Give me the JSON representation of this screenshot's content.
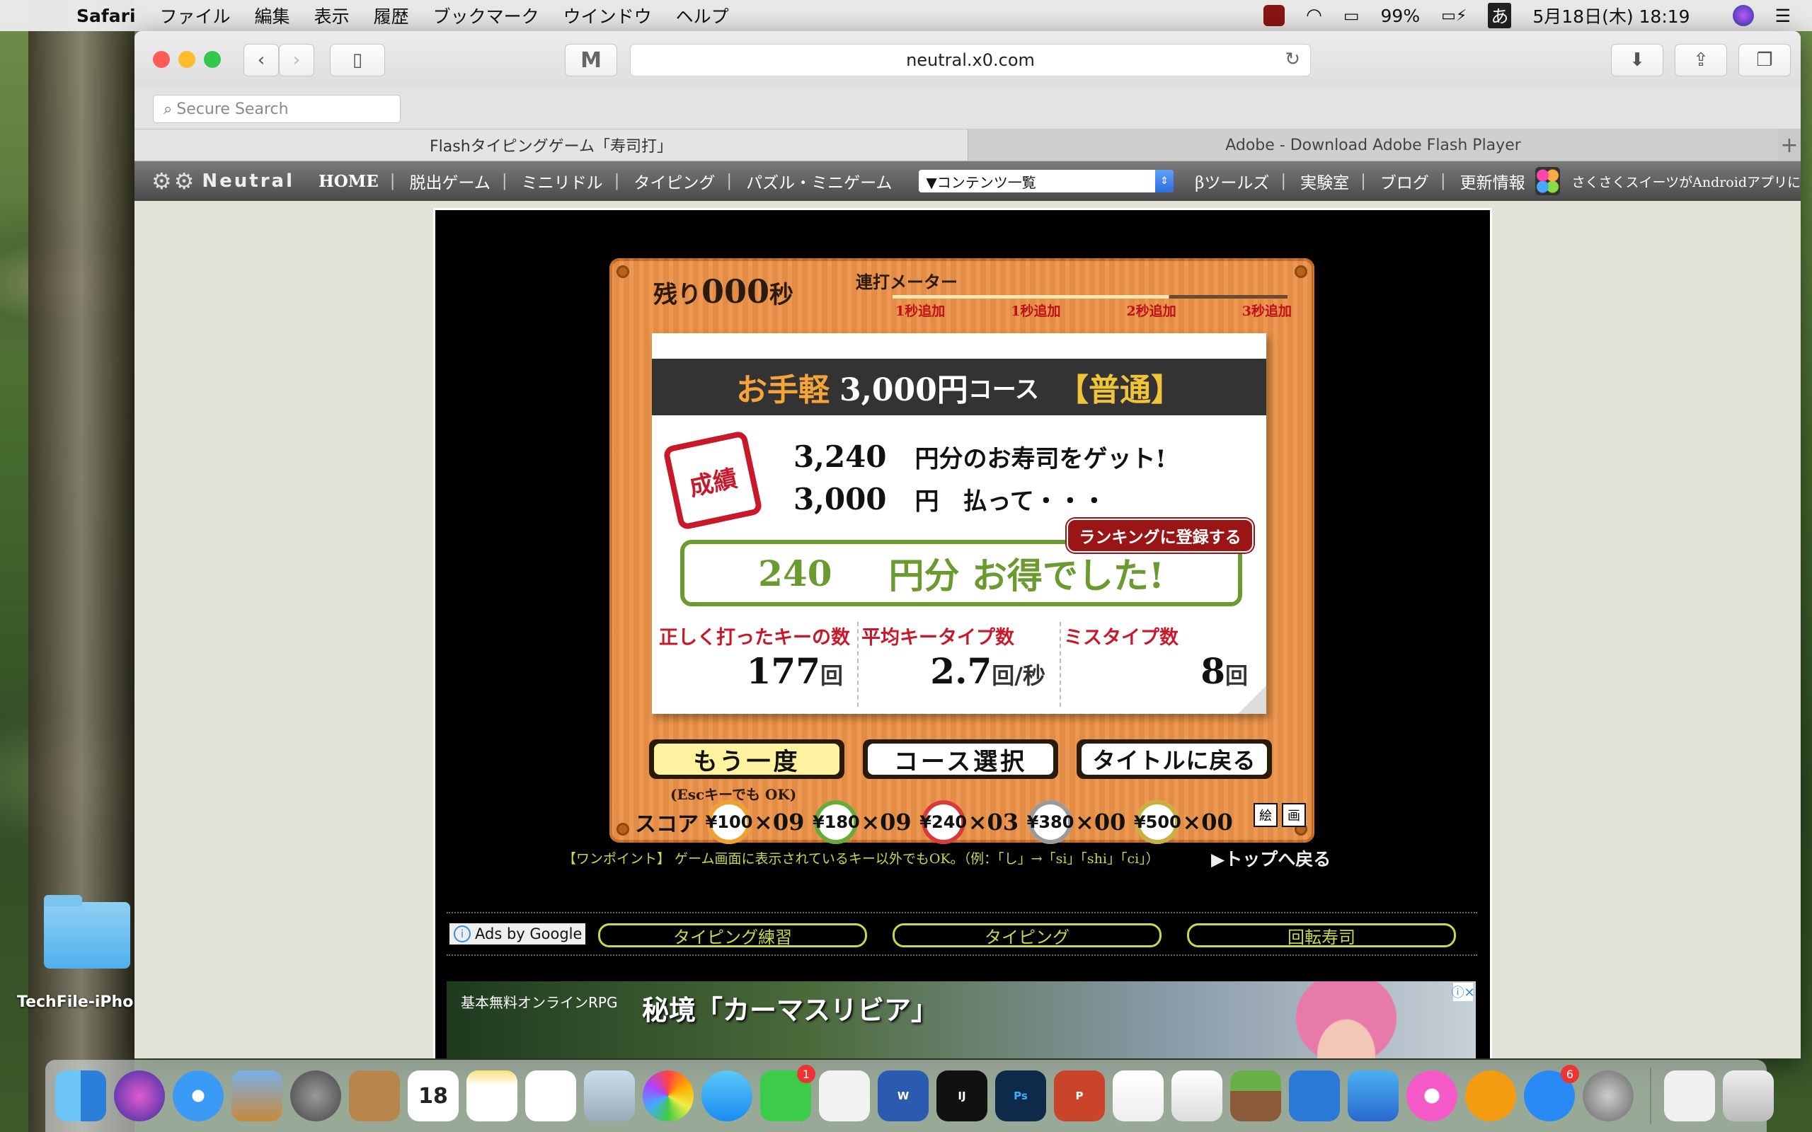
{
  "menubar": {
    "app": "Safari",
    "items": [
      "ファイル",
      "編集",
      "表示",
      "履歴",
      "ブックマーク",
      "ウインドウ",
      "ヘルプ"
    ],
    "battery": "99%",
    "input_method": "あ",
    "datetime": "5月18日(木) 18:19"
  },
  "safari": {
    "url": "neutral.x0.com",
    "search_placeholder": "Secure Search",
    "tabs": [
      {
        "title": "Flashタイピングゲーム「寿司打」"
      },
      {
        "title": "Adobe - Download Adobe Flash Player"
      }
    ],
    "new_tab": "+"
  },
  "site_nav": {
    "logo": "Neutral",
    "items": [
      "HOME",
      "脱出ゲーム",
      "ミニリドル",
      "タイピング",
      "パズル・ミニゲーム"
    ],
    "contents_select": "▼コンテンツ一覧",
    "items2": [
      "βツールズ",
      "実験室",
      "ブログ",
      "更新情報"
    ],
    "news_text": "さくさくスイーツがAndroidアプリに"
  },
  "game": {
    "timer_prefix": "残り",
    "timer_value": "000",
    "timer_unit": "秒",
    "meter_label": "連打メーター",
    "meter_marks": [
      "1秒追加",
      "1秒追加",
      "2秒追加",
      "3秒追加"
    ],
    "course_prefix": "お手軽",
    "course_amount": "3,000円",
    "course_suffix": "コース",
    "course_level": "【普通】",
    "stamp": "成績",
    "earned_value": "3,240",
    "earned_text": "円分のお寿司をゲット!",
    "paid_value": "3,000",
    "paid_text": "円　払って・・・",
    "rank_button": "ランキングに登録する",
    "gain_value": "240",
    "gain_text": "円分 お得でした!",
    "stats": [
      {
        "label": "正しく打ったキーの数",
        "value": "177",
        "unit": "回"
      },
      {
        "label": "平均キータイプ数",
        "value": "2.7",
        "unit": "回/秒"
      },
      {
        "label": "ミスタイプ数",
        "value": "8",
        "unit": "回"
      }
    ],
    "buttons": {
      "retry": "もう一度",
      "course_select": "コース選択",
      "title": "タイトルに戻る"
    },
    "esc_note": "(Escキーでも OK)",
    "score_label": "スコア",
    "plates": [
      {
        "price": "¥100",
        "count": "×09",
        "color": "#f0a030"
      },
      {
        "price": "¥180",
        "count": "×09",
        "color": "#6aa838"
      },
      {
        "price": "¥240",
        "count": "×03",
        "color": "#d83a3a"
      },
      {
        "price": "¥380",
        "count": "×00",
        "color": "#9a9a9a"
      },
      {
        "price": "¥500",
        "count": "×00",
        "color": "#c8b040"
      }
    ],
    "corner_icons": [
      "絵",
      "画"
    ]
  },
  "tip": "【ワンポイント】 ゲーム画面に表示されているキー以外でもOK。（例：「し」→「si」「shi」「ci」）",
  "back_to_top": "▶トップへ戻る",
  "ads": {
    "label": "Ads by Google",
    "links": [
      "タイピング練習",
      "タイピング",
      "回転寿司"
    ],
    "banner_small": "基本無料オンラインRPG",
    "banner_title": "秘境「カーマスリビア」"
  },
  "desktop": {
    "folder_label": "TechFile-iPho"
  },
  "dock": {
    "calendar_day": "18",
    "facetime_badge": "1",
    "appstore_badge": "6"
  }
}
